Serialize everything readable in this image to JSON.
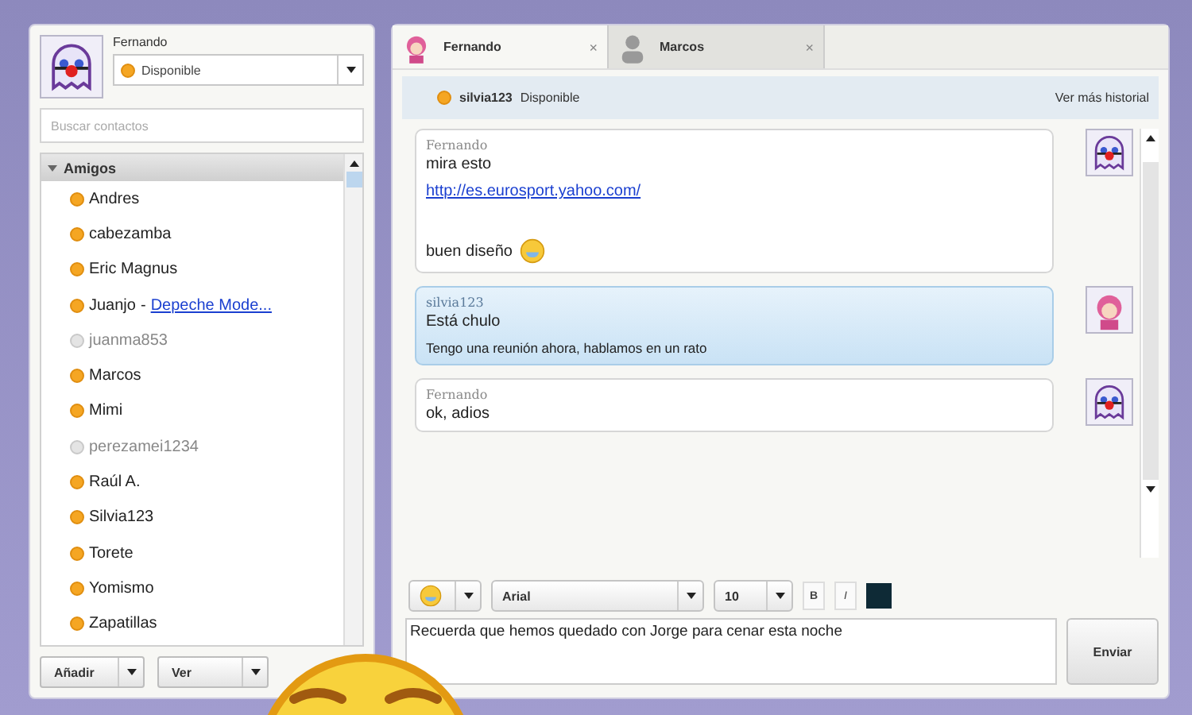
{
  "profile": {
    "name": "Fernando",
    "status": "Disponible"
  },
  "search": {
    "placeholder": "Buscar contactos"
  },
  "group": {
    "label": "Amigos",
    "expanded": true
  },
  "contacts": [
    {
      "name": "Andres",
      "online": true
    },
    {
      "name": "cabezamba",
      "online": true
    },
    {
      "name": "Eric Magnus",
      "online": true
    },
    {
      "name": "Juanjo",
      "online": true,
      "separator": "-",
      "status_message": "Depeche Mode..."
    },
    {
      "name": "juanma853",
      "online": false
    },
    {
      "name": "Marcos",
      "online": true
    },
    {
      "name": "Mimi",
      "online": true
    },
    {
      "name": "perezamei1234",
      "online": false
    },
    {
      "name": "Raúl A.",
      "online": true
    },
    {
      "name": "Silvia123",
      "online": true
    },
    {
      "name": "Torete",
      "online": true
    },
    {
      "name": "Yomismo",
      "online": true
    },
    {
      "name": "Zapatillas",
      "online": true
    }
  ],
  "left_buttons": [
    "Añadir",
    "Ver"
  ],
  "tabs": [
    {
      "label": "Fernando",
      "selected": true,
      "close": "×"
    },
    {
      "label": "Marcos",
      "selected": false,
      "close": "×"
    }
  ],
  "chat_header": {
    "contact": "silvia123",
    "status": "Disponible",
    "history_link": "Ver más historial"
  },
  "messages": [
    {
      "kind": "own",
      "sender": "Fernando",
      "lines": [
        {
          "kind": "text",
          "text": "mira esto"
        },
        {
          "kind": "link",
          "text": "http://es.eurosport.yahoo.com/"
        },
        {
          "kind": "gap"
        },
        {
          "kind": "emoticon",
          "text": "buen diseño"
        }
      ]
    },
    {
      "kind": "contact",
      "sender": "silvia123",
      "lines": [
        {
          "kind": "text",
          "text": "Está chulo"
        },
        {
          "kind": "text",
          "text": "Tengo una reunión ahora, hablamos en un rato"
        }
      ]
    },
    {
      "kind": "own",
      "sender": "Fernando",
      "lines": [
        {
          "kind": "text",
          "text": "ok, adios"
        }
      ]
    }
  ],
  "format_bar": {
    "font": "Arial",
    "size": "10",
    "bold": "B",
    "italic": "I"
  },
  "composer": {
    "value": "Recuerda que hemos quedado con Jorge para cenar esta noche"
  },
  "send_button": "Enviar"
}
